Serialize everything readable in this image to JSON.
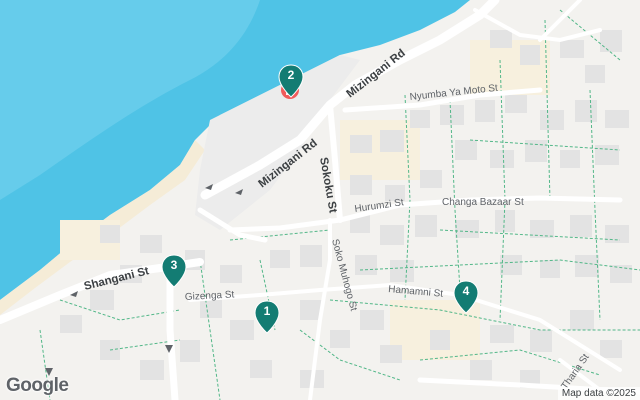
{
  "map": {
    "colors": {
      "sea": "#4fc3e6",
      "sea_deep": "#7ad3ef",
      "land": "#f3f2ef",
      "beach": "#f5ecd7",
      "block": "#e4e4e4",
      "road": "#ffffff",
      "minor_path": "#52b788",
      "marker": "#137c73",
      "poi": "#f15b5b"
    },
    "roads": {
      "mizingani_1": "Mizingani Rd",
      "mizingani_2": "Mizingani Rd",
      "sokoku": "Sokoku St",
      "shangani": "Shangani St"
    },
    "streets": {
      "nyumba": "Nyumba Ya Moto St",
      "hurumzi": "Hurumzi St",
      "changa": "Changa Bazaar St",
      "soko_muhogo": "Soko Muhogo St",
      "gizenga": "Gizenga St",
      "hamamni": "Hamamni St",
      "tharia": "Tharia St"
    },
    "markers": [
      {
        "label": "1"
      },
      {
        "label": "2"
      },
      {
        "label": "3"
      },
      {
        "label": "4"
      }
    ],
    "poi_icon": "flag-icon",
    "logo": "Google",
    "attribution": "Map data ©2025"
  }
}
